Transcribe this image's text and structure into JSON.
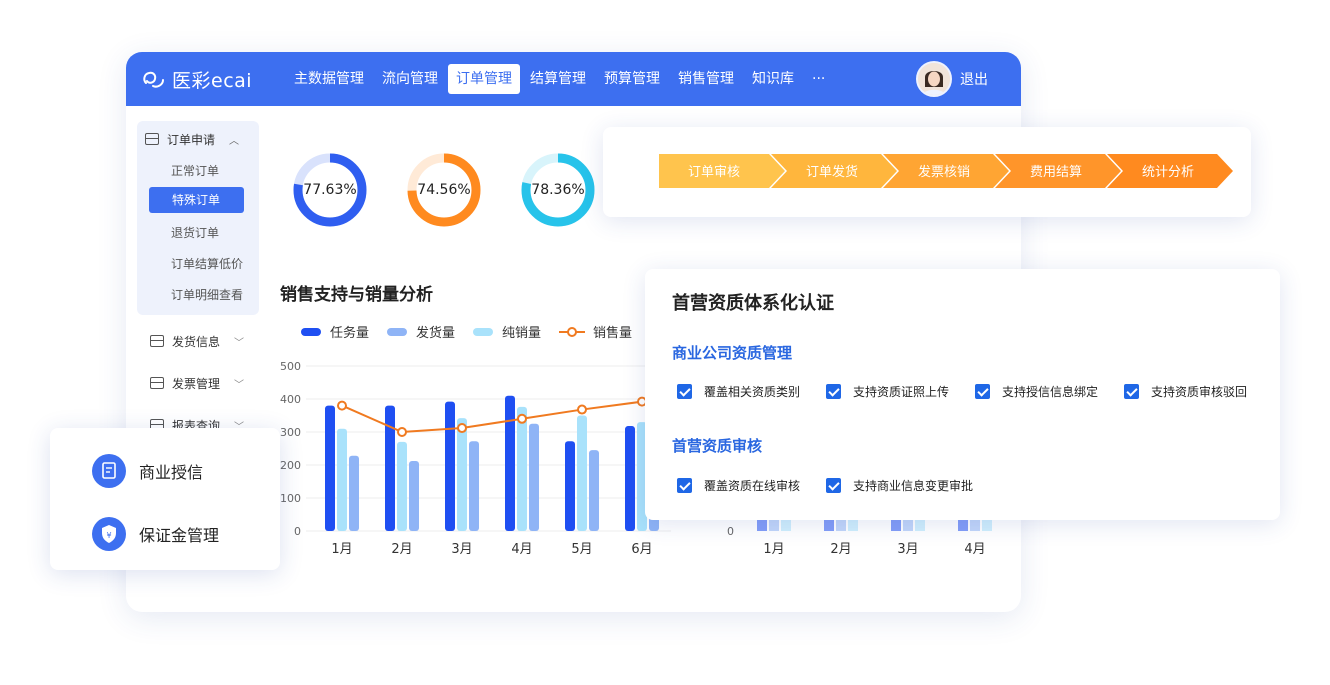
{
  "app": {
    "logo_text": "医彩ecai",
    "nav": [
      "主数据管理",
      "流向管理",
      "订单管理",
      "结算管理",
      "预算管理",
      "销售管理",
      "知识库",
      "···"
    ],
    "active_nav": "订单管理",
    "logout": "退出"
  },
  "sidebar": {
    "group_title": "订单申请",
    "sub_items": [
      "正常订单",
      "特殊订单",
      "退货订单",
      "订单结算低价",
      "订单明细查看"
    ],
    "active_sub": "特殊订单",
    "items": [
      "发货信息",
      "发票管理",
      "报表查询"
    ]
  },
  "progress_rings": [
    {
      "label": "77.63%",
      "value": 77.63,
      "color": "#2f5ef0"
    },
    {
      "label": "74.56%",
      "value": 74.56,
      "color": "#ff8a1f"
    },
    {
      "label": "78.36%",
      "value": 78.36,
      "color": "#27c3ea"
    }
  ],
  "chart_data": [
    {
      "type": "bar",
      "title": "销售支持与销量分析",
      "categories": [
        "1月",
        "2月",
        "3月",
        "4月",
        "5月",
        "6月"
      ],
      "yticks": [
        "500",
        "400",
        "300",
        "200",
        "100",
        "0"
      ],
      "ylim": [
        0,
        500
      ],
      "legend": [
        "任务量",
        "发货量",
        "纯销量",
        "销售量"
      ],
      "series": [
        {
          "name": "任务量",
          "type": "bar",
          "color": "#1f4ff2",
          "values": [
            380,
            380,
            392,
            410,
            272,
            318
          ]
        },
        {
          "name": "纯销量",
          "type": "bar",
          "color": "#a9e2fb",
          "values": [
            310,
            270,
            342,
            376,
            350,
            330
          ]
        },
        {
          "name": "发货量",
          "type": "bar",
          "color": "#8fb4f6",
          "values": [
            228,
            212,
            272,
            325,
            245,
            270
          ]
        },
        {
          "name": "销售量",
          "type": "line",
          "color": "#f07a20",
          "values": [
            380,
            300,
            312,
            340,
            368,
            392
          ]
        }
      ]
    },
    {
      "type": "bar",
      "categories": [
        "1月",
        "2月",
        "3月",
        "4月"
      ],
      "ytick_zero": "0"
    }
  ],
  "process_steps": [
    "订单审核",
    "订单发货",
    "发票核销",
    "费用结算",
    "统计分析"
  ],
  "qualification": {
    "title": "首营资质体系化认证",
    "sections": [
      {
        "title": "商业公司资质管理",
        "items": [
          "覆盖相关资质类别",
          "支持资质证照上传",
          "支持授信信息绑定",
          "支持资质审核驳回"
        ]
      },
      {
        "title": "首营资质审核",
        "items": [
          "覆盖资质在线审核",
          "支持商业信息变更审批"
        ]
      }
    ]
  },
  "credit_card": {
    "items": [
      {
        "label": "商业授信",
        "icon": "document-icon"
      },
      {
        "label": "保证金管理",
        "icon": "shield-yuan-icon"
      }
    ]
  }
}
